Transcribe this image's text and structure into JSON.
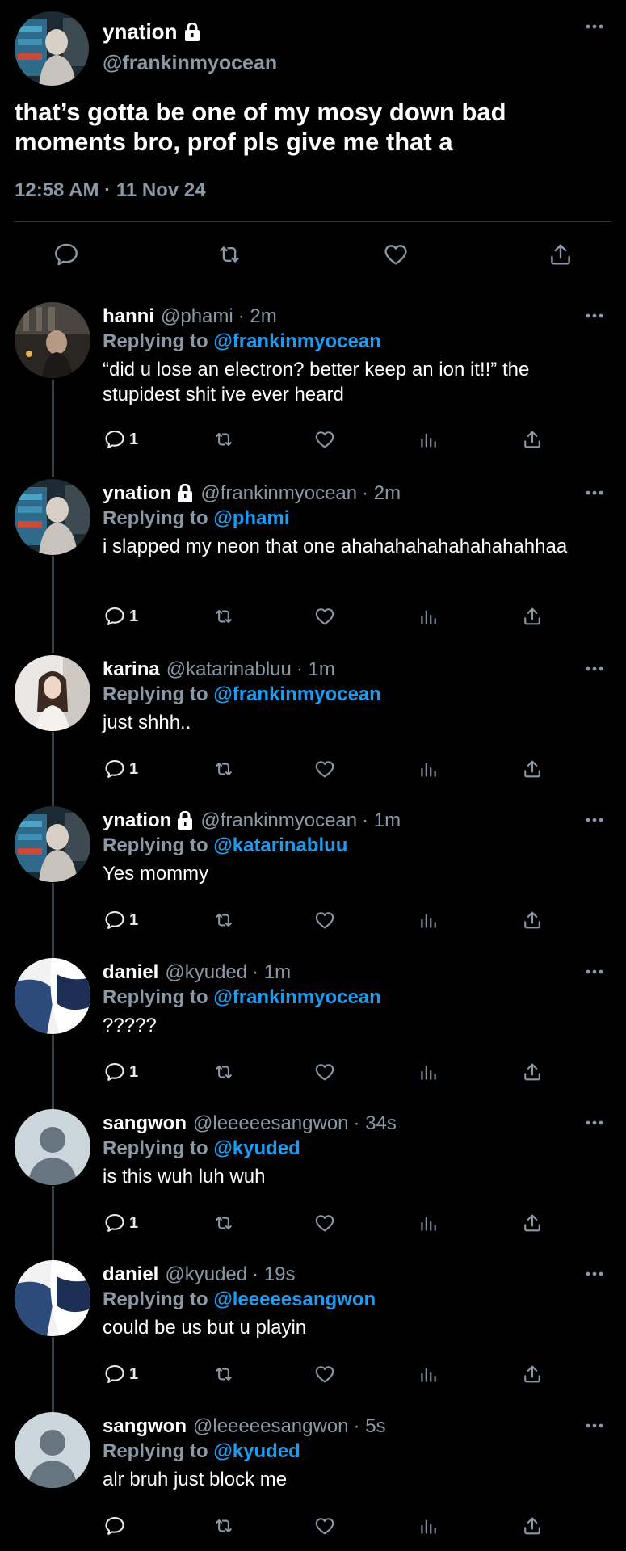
{
  "main": {
    "name": "ynation",
    "handle": "@frankinmyocean",
    "text": "that’s gotta be one of my mosy down bad moments bro, prof pls give me that a",
    "timestamp": "12:58 AM · 11 Nov 24",
    "avatar_icon": "avatar-photo-ynation"
  },
  "replying_prefix": "Replying to",
  "replies": [
    {
      "name": "hanni",
      "handle": "@phami",
      "time": "· 2m",
      "locked": false,
      "replying_to": "@frankinmyocean",
      "text": "“did u lose an electron? better keep an ion it!!” the stupidest shit ive ever heard",
      "reply_count": "1",
      "avatar": "photo-hanni"
    },
    {
      "name": "ynation",
      "handle": "@frankinmyocean",
      "time": "· 2m",
      "locked": true,
      "replying_to": "@phami",
      "text": "i slapped my neon that one ahahahahahahahahahhaa",
      "reply_count": "1",
      "avatar": "photo-ynation"
    },
    {
      "name": "karina",
      "handle": "@katarinabluu",
      "time": "· 1m",
      "locked": false,
      "replying_to": "@frankinmyocean",
      "text": "just shhh..",
      "reply_count": "1",
      "avatar": "photo-karina"
    },
    {
      "name": "ynation",
      "handle": "@frankinmyocean",
      "time": "· 1m",
      "locked": true,
      "replying_to": "@katarinabluu",
      "text": "Yes mommy",
      "reply_count": "1",
      "avatar": "photo-ynation"
    },
    {
      "name": "daniel",
      "handle": "@kyuded",
      "time": "· 1m",
      "locked": false,
      "replying_to": "@frankinmyocean",
      "text": "?????",
      "reply_count": "1",
      "avatar": "photo-daniel"
    },
    {
      "name": "sangwon",
      "handle": "@leeeeesangwon",
      "time": "· 34s",
      "locked": false,
      "replying_to": "@kyuded",
      "text": "is this wuh luh wuh",
      "reply_count": "1",
      "avatar": "default-avatar"
    },
    {
      "name": "daniel",
      "handle": "@kyuded",
      "time": "· 19s",
      "locked": false,
      "replying_to": "@leeeeesangwon",
      "text": "could be us but u playin",
      "reply_count": "1",
      "avatar": "photo-daniel"
    },
    {
      "name": "sangwon",
      "handle": "@leeeeesangwon",
      "time": "· 5s",
      "locked": false,
      "replying_to": "@kyuded",
      "text": "alr bruh just block me",
      "reply_count": "",
      "avatar": "default-avatar"
    }
  ],
  "colors": {
    "background": "#000000",
    "accent": "#1d9bf0",
    "secondary_text": "#8b98a5",
    "divider": "#2f3336"
  }
}
